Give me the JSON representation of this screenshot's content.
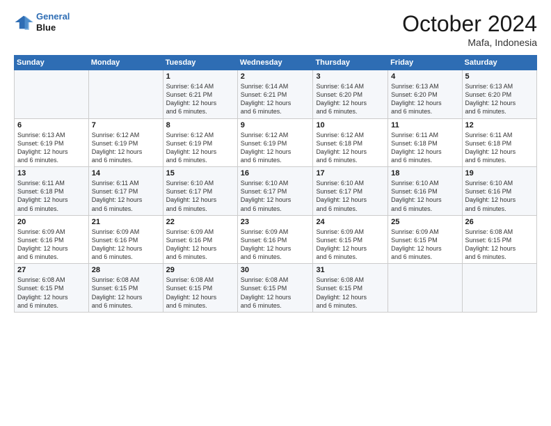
{
  "header": {
    "logo_line1": "General",
    "logo_line2": "Blue",
    "month": "October 2024",
    "location": "Mafa, Indonesia"
  },
  "weekdays": [
    "Sunday",
    "Monday",
    "Tuesday",
    "Wednesday",
    "Thursday",
    "Friday",
    "Saturday"
  ],
  "weeks": [
    [
      {
        "day": "",
        "info": ""
      },
      {
        "day": "",
        "info": ""
      },
      {
        "day": "1",
        "info": "Sunrise: 6:14 AM\nSunset: 6:21 PM\nDaylight: 12 hours\nand 6 minutes."
      },
      {
        "day": "2",
        "info": "Sunrise: 6:14 AM\nSunset: 6:21 PM\nDaylight: 12 hours\nand 6 minutes."
      },
      {
        "day": "3",
        "info": "Sunrise: 6:14 AM\nSunset: 6:20 PM\nDaylight: 12 hours\nand 6 minutes."
      },
      {
        "day": "4",
        "info": "Sunrise: 6:13 AM\nSunset: 6:20 PM\nDaylight: 12 hours\nand 6 minutes."
      },
      {
        "day": "5",
        "info": "Sunrise: 6:13 AM\nSunset: 6:20 PM\nDaylight: 12 hours\nand 6 minutes."
      }
    ],
    [
      {
        "day": "6",
        "info": "Sunrise: 6:13 AM\nSunset: 6:19 PM\nDaylight: 12 hours\nand 6 minutes."
      },
      {
        "day": "7",
        "info": "Sunrise: 6:12 AM\nSunset: 6:19 PM\nDaylight: 12 hours\nand 6 minutes."
      },
      {
        "day": "8",
        "info": "Sunrise: 6:12 AM\nSunset: 6:19 PM\nDaylight: 12 hours\nand 6 minutes."
      },
      {
        "day": "9",
        "info": "Sunrise: 6:12 AM\nSunset: 6:19 PM\nDaylight: 12 hours\nand 6 minutes."
      },
      {
        "day": "10",
        "info": "Sunrise: 6:12 AM\nSunset: 6:18 PM\nDaylight: 12 hours\nand 6 minutes."
      },
      {
        "day": "11",
        "info": "Sunrise: 6:11 AM\nSunset: 6:18 PM\nDaylight: 12 hours\nand 6 minutes."
      },
      {
        "day": "12",
        "info": "Sunrise: 6:11 AM\nSunset: 6:18 PM\nDaylight: 12 hours\nand 6 minutes."
      }
    ],
    [
      {
        "day": "13",
        "info": "Sunrise: 6:11 AM\nSunset: 6:18 PM\nDaylight: 12 hours\nand 6 minutes."
      },
      {
        "day": "14",
        "info": "Sunrise: 6:11 AM\nSunset: 6:17 PM\nDaylight: 12 hours\nand 6 minutes."
      },
      {
        "day": "15",
        "info": "Sunrise: 6:10 AM\nSunset: 6:17 PM\nDaylight: 12 hours\nand 6 minutes."
      },
      {
        "day": "16",
        "info": "Sunrise: 6:10 AM\nSunset: 6:17 PM\nDaylight: 12 hours\nand 6 minutes."
      },
      {
        "day": "17",
        "info": "Sunrise: 6:10 AM\nSunset: 6:17 PM\nDaylight: 12 hours\nand 6 minutes."
      },
      {
        "day": "18",
        "info": "Sunrise: 6:10 AM\nSunset: 6:16 PM\nDaylight: 12 hours\nand 6 minutes."
      },
      {
        "day": "19",
        "info": "Sunrise: 6:10 AM\nSunset: 6:16 PM\nDaylight: 12 hours\nand 6 minutes."
      }
    ],
    [
      {
        "day": "20",
        "info": "Sunrise: 6:09 AM\nSunset: 6:16 PM\nDaylight: 12 hours\nand 6 minutes."
      },
      {
        "day": "21",
        "info": "Sunrise: 6:09 AM\nSunset: 6:16 PM\nDaylight: 12 hours\nand 6 minutes."
      },
      {
        "day": "22",
        "info": "Sunrise: 6:09 AM\nSunset: 6:16 PM\nDaylight: 12 hours\nand 6 minutes."
      },
      {
        "day": "23",
        "info": "Sunrise: 6:09 AM\nSunset: 6:16 PM\nDaylight: 12 hours\nand 6 minutes."
      },
      {
        "day": "24",
        "info": "Sunrise: 6:09 AM\nSunset: 6:15 PM\nDaylight: 12 hours\nand 6 minutes."
      },
      {
        "day": "25",
        "info": "Sunrise: 6:09 AM\nSunset: 6:15 PM\nDaylight: 12 hours\nand 6 minutes."
      },
      {
        "day": "26",
        "info": "Sunrise: 6:08 AM\nSunset: 6:15 PM\nDaylight: 12 hours\nand 6 minutes."
      }
    ],
    [
      {
        "day": "27",
        "info": "Sunrise: 6:08 AM\nSunset: 6:15 PM\nDaylight: 12 hours\nand 6 minutes."
      },
      {
        "day": "28",
        "info": "Sunrise: 6:08 AM\nSunset: 6:15 PM\nDaylight: 12 hours\nand 6 minutes."
      },
      {
        "day": "29",
        "info": "Sunrise: 6:08 AM\nSunset: 6:15 PM\nDaylight: 12 hours\nand 6 minutes."
      },
      {
        "day": "30",
        "info": "Sunrise: 6:08 AM\nSunset: 6:15 PM\nDaylight: 12 hours\nand 6 minutes."
      },
      {
        "day": "31",
        "info": "Sunrise: 6:08 AM\nSunset: 6:15 PM\nDaylight: 12 hours\nand 6 minutes."
      },
      {
        "day": "",
        "info": ""
      },
      {
        "day": "",
        "info": ""
      }
    ]
  ]
}
